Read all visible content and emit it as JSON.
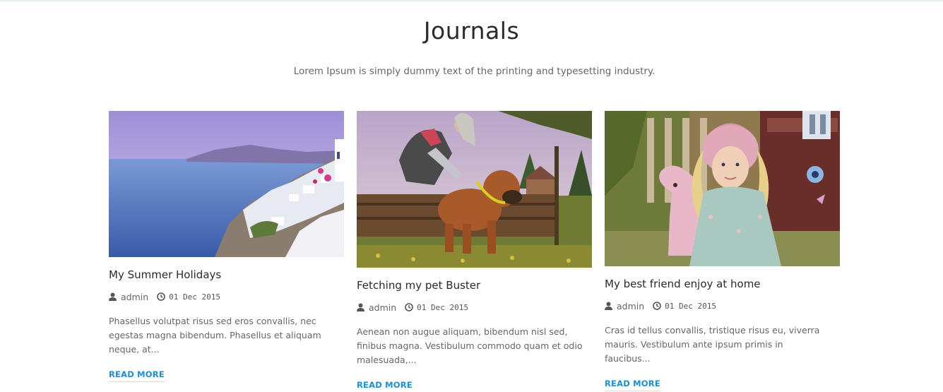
{
  "section": {
    "title": "Journals",
    "subtitle": "Lorem Ipsum is simply dummy text of the printing and typesetting industry."
  },
  "posts": [
    {
      "title": "My Summer Holidays",
      "author": "admin",
      "date": "01 Dec 2015",
      "excerpt": "Phasellus volutpat risus sed eros convallis, nec egestas magna bibendum. Phasellus et aliquam neque, at...",
      "read_more": "READ MORE"
    },
    {
      "title": "Fetching my pet Buster",
      "author": "admin",
      "date": "01 Dec 2015",
      "excerpt": "Aenean non augue aliquam, bibendum nisl sed, finibus magna. Vestibulum commodo quam et odio malesuada,...",
      "read_more": "READ MORE"
    },
    {
      "title": "My best friend enjoy at home",
      "author": "admin",
      "date": "01 Dec 2015",
      "excerpt": "Cras id tellus convallis, tristique risus eu, viverra mauris. Vestibulum ante ipsum primis in faucibus...",
      "read_more": "READ MORE"
    }
  ],
  "icons": {
    "author": "user-icon",
    "date": "clock-icon"
  },
  "colors": {
    "accent": "#1a8fd6",
    "title": "#2a2a2a",
    "text": "#666666"
  }
}
